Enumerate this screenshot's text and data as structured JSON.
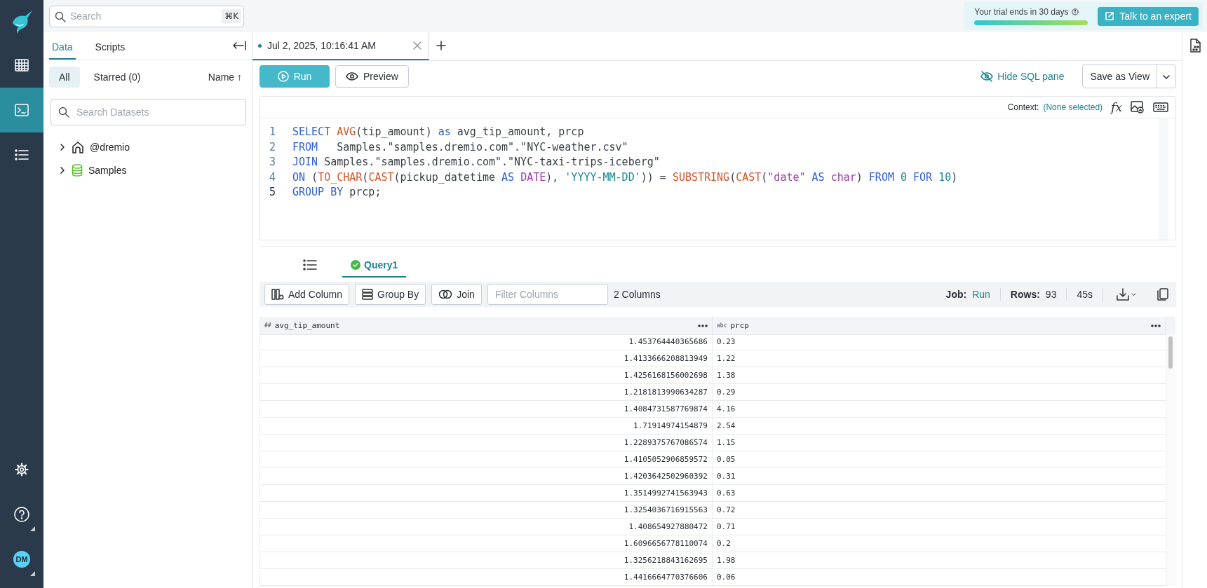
{
  "nav": {
    "items": [
      {
        "kind": "datasets",
        "selected": false
      },
      {
        "kind": "sql",
        "selected": true
      },
      {
        "kind": "jobs",
        "selected": false
      }
    ],
    "user": {
      "initials": "DM"
    }
  },
  "search": {
    "placeholder": "Search",
    "shortcut": "⌘K"
  },
  "trial": {
    "text": "Your trial ends in 30 days",
    "level": 1,
    "button": "Talk to an expert"
  },
  "left_panel": {
    "tabs": [
      {
        "label": "Data",
        "selected": true
      },
      {
        "label": "Scripts",
        "selected": false
      }
    ],
    "filters": [
      {
        "label": "All",
        "selected": true
      },
      {
        "label": "Starred (0)",
        "selected": false
      }
    ],
    "sort": "Name ↑",
    "search": {
      "placeholder": "Search Datasets"
    },
    "tree": [
      {
        "label": "@dremio",
        "kind": "home",
        "expanded": false
      },
      {
        "label": "Samples",
        "kind": "source",
        "expanded": false
      }
    ]
  },
  "editor_tabs": [
    {
      "label": "Jul 2, 2025, 10:16:41 AM",
      "selected": true
    }
  ],
  "toolbar": {
    "run": "Run",
    "preview": "Preview",
    "hide_sql": "Hide SQL pane",
    "save_view": "Save as View"
  },
  "editor": {
    "context_label": "Context:",
    "context_value": "(None selected)",
    "function_icon": "fx",
    "lines": [
      {
        "number": "1",
        "current": false,
        "tokens": [
          {
            "kind": "keyword",
            "text": "SELECT "
          },
          {
            "kind": "function",
            "text": "AVG"
          },
          {
            "kind": "plain",
            "text": "(tip_amount) "
          },
          {
            "kind": "keyword",
            "text": "as"
          },
          {
            "kind": "plain",
            "text": " avg_tip_amount, prcp"
          }
        ]
      },
      {
        "number": "2",
        "current": false,
        "tokens": [
          {
            "kind": "keyword",
            "text": "FROM   "
          },
          {
            "kind": "plain",
            "text": "Samples.\"samples.dremio.com\".\"NYC-weather.csv\""
          }
        ]
      },
      {
        "number": "3",
        "current": false,
        "tokens": [
          {
            "kind": "keyword",
            "text": "JOIN "
          },
          {
            "kind": "plain",
            "text": "Samples.\"samples.dremio.com\".\"NYC-taxi-trips-iceberg\""
          }
        ]
      },
      {
        "number": "4",
        "current": false,
        "tokens": [
          {
            "kind": "keyword",
            "text": "ON "
          },
          {
            "kind": "plain",
            "text": "("
          },
          {
            "kind": "function",
            "text": "TO_CHAR"
          },
          {
            "kind": "plain",
            "text": "("
          },
          {
            "kind": "function",
            "text": "CAST"
          },
          {
            "kind": "plain",
            "text": "(pickup_datetime "
          },
          {
            "kind": "keyword",
            "text": "AS "
          },
          {
            "kind": "type",
            "text": "DATE"
          },
          {
            "kind": "plain",
            "text": "), "
          },
          {
            "kind": "string",
            "text": "'YYYY-MM-DD'"
          },
          {
            "kind": "plain",
            "text": ")) = "
          },
          {
            "kind": "function",
            "text": "SUBSTRING"
          },
          {
            "kind": "plain",
            "text": "("
          },
          {
            "kind": "function",
            "text": "CAST"
          },
          {
            "kind": "plain",
            "text": "("
          },
          {
            "kind": "type",
            "text": "\"date\""
          },
          {
            "kind": "keyword",
            "text": " AS "
          },
          {
            "kind": "type",
            "text": "char"
          },
          {
            "kind": "plain",
            "text": ") "
          },
          {
            "kind": "keyword",
            "text": "FROM "
          },
          {
            "kind": "number",
            "text": "0"
          },
          {
            "kind": "keyword",
            "text": " FOR "
          },
          {
            "kind": "number",
            "text": "10"
          },
          {
            "kind": "plain",
            "text": ")"
          }
        ]
      },
      {
        "number": "5",
        "current": true,
        "tokens": [
          {
            "kind": "keyword",
            "text": "GROUP BY "
          },
          {
            "kind": "plain",
            "text": "prcp;"
          }
        ]
      }
    ]
  },
  "results": {
    "tabs": [
      {
        "kind": "icon",
        "selected": false
      },
      {
        "kind": "label",
        "label": "Query1",
        "selected": true
      }
    ],
    "buttons": [
      {
        "kind": "add_column",
        "label": "Add Column"
      },
      {
        "kind": "group_by",
        "label": "Group By"
      },
      {
        "kind": "join",
        "label": "Join"
      }
    ],
    "filter": {
      "placeholder": "Filter Columns"
    },
    "column_count": "2 Columns",
    "job_label": "Job:",
    "job_value": "Run",
    "rows_label": "Rows:",
    "rows_value": "93",
    "duration": "45s"
  },
  "table": {
    "columns": [
      {
        "label": "avg_tip_amount",
        "type": "##"
      },
      {
        "label": "prcp",
        "type": "abc"
      }
    ],
    "rows": [
      [
        "1.453764440365686",
        "0.23"
      ],
      [
        "1.4133666208813949",
        "1.22"
      ],
      [
        "1.4256168156002698",
        "1.38"
      ],
      [
        "1.2181813990634287",
        "0.29"
      ],
      [
        "1.4084731587769874",
        "4.16"
      ],
      [
        "1.71914974154879",
        "2.54"
      ],
      [
        "1.2289375767086574",
        "1.15"
      ],
      [
        "1.4105052906859572",
        "0.05"
      ],
      [
        "1.4203642502960392",
        "0.31"
      ],
      [
        "1.3514992741563943",
        "0.63"
      ],
      [
        "1.3254036716915563",
        "0.72"
      ],
      [
        "1.408654927880472",
        "0.71"
      ],
      [
        "1.6096656778110074",
        "0.2"
      ],
      [
        "1.3256218843162695",
        "1.98"
      ],
      [
        "1.4416664770376606",
        "0.06"
      ]
    ]
  }
}
